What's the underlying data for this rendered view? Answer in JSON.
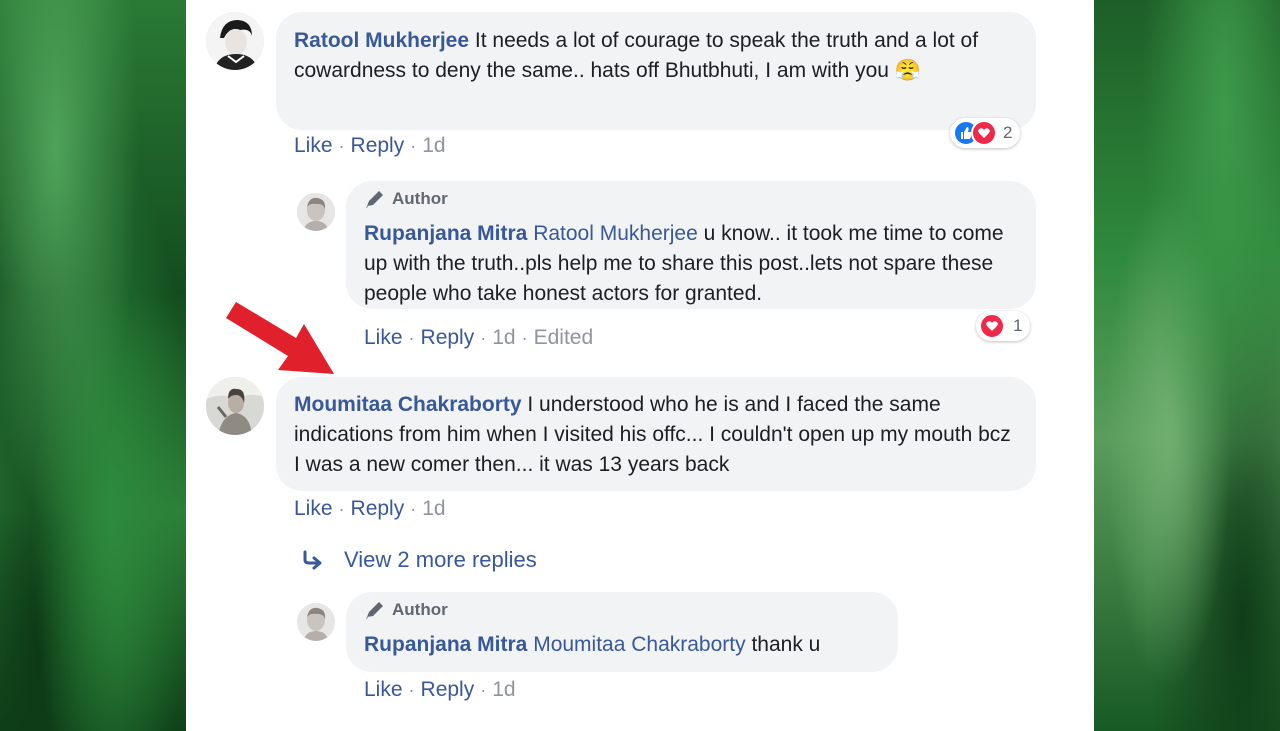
{
  "comments": [
    {
      "name": "Ratool Mukherjee",
      "text": "It needs a lot of courage to speak the truth and a lot of cowardness to deny the same.. hats off Bhutbhuti, I am with you",
      "emoji": "😤",
      "actions": {
        "like": "Like",
        "reply": "Reply",
        "time": "1d"
      },
      "reaction_count": "2",
      "replies": [
        {
          "badge": "Author",
          "name": "Rupanjana Mitra",
          "mention": "Ratool Mukherjee",
          "text": "u know.. it took me time to come up with the truth..pls help me to share this post..lets not spare these people who take honest actors for granted.",
          "actions": {
            "like": "Like",
            "reply": "Reply",
            "time": "1d",
            "edited": "Edited"
          },
          "reaction_count": "1"
        }
      ]
    },
    {
      "name": "Moumitaa Chakraborty",
      "text": "I understood who he is and I faced the same indications from him when I visited his offc... I couldn't open up my mouth bcz I was a new comer then... it was 13 years back",
      "actions": {
        "like": "Like",
        "reply": "Reply",
        "time": "1d"
      },
      "view_more": "View 2 more replies",
      "replies": [
        {
          "badge": "Author",
          "name": "Rupanjana Mitra",
          "mention": "Moumitaa Chakraborty",
          "text": "thank u",
          "actions": {
            "like": "Like",
            "reply": "Reply",
            "time": "1d"
          }
        }
      ]
    }
  ],
  "colors": {
    "name": "#385898",
    "bubble": "#f2f3f5",
    "arrow": "#e0202a",
    "like_blue": "#1877f2",
    "love_red": "#f0284a"
  }
}
